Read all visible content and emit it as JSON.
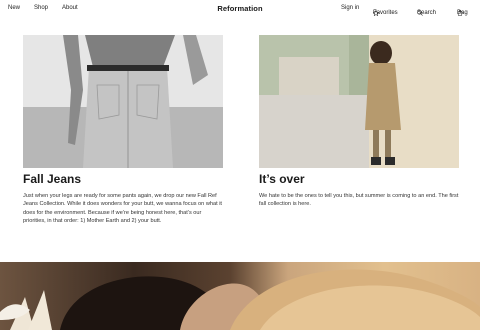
{
  "nav": {
    "left": [
      "New",
      "Shop",
      "About"
    ],
    "brand": "Reformation",
    "sign_in": "Sign in",
    "favorites": "Favorites",
    "search": "Search",
    "bag": "Bag"
  },
  "cards": [
    {
      "title": "Fall Jeans",
      "body": "Just when your legs are ready for some pants again, we drop our new Fall Ref Jeans Collection. While it does wonders for your butt, we wanna focus on what it does for the environment. Because if we’re being honest here, that’s our priorities, in that order: 1) Mother Earth and 2) your butt."
    },
    {
      "title": "It’s over",
      "body": "We hate to be the ones to tell you this, but summer is coming to an end. The first fall collection is here."
    }
  ],
  "icons": {
    "favorites": "star-icon",
    "search": "search-icon",
    "bag": "bag-icon"
  }
}
